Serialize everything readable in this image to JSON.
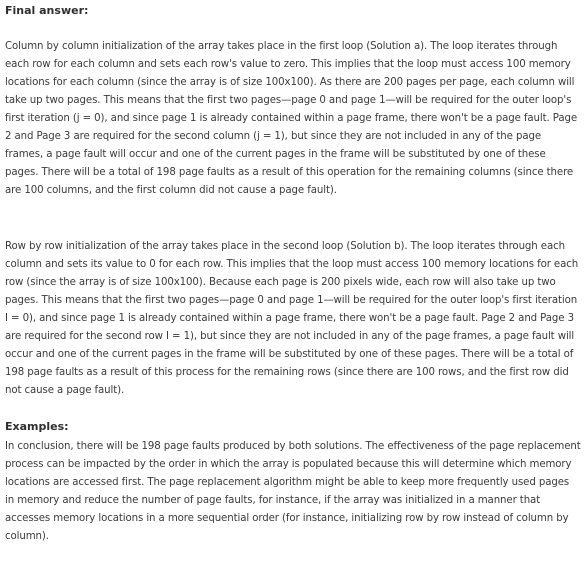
{
  "final_answer": {
    "heading": "Final answer:",
    "paragraph_1": "Column by column initialization of the array takes place in the first loop (Solution a). The loop iterates through each row for each column and sets each row's value to zero. This implies that the loop must access 100 memory locations for each column (since the array is of size 100x100). As there are 200 pages per page, each column will take up two pages. This means that the first two pages—page 0 and page 1—will be required for the outer loop's first iteration (j = 0), and since page 1 is already contained within a page frame, there won't be a page fault. Page 2 and Page 3 are required for the second column (j = 1), but since they are not included in any of the page frames, a page fault will occur and one of the current pages in the frame will be substituted by one of these pages. There will be a total of 198 page faults as a result of this operation for the remaining columns (since there are 100 columns, and the first column did not cause a page fault).",
    "paragraph_2": "Row by row initialization of the array takes place in the second loop (Solution b). The loop iterates through each column and sets its value to 0 for each row. This implies that the loop must access 100 memory locations for each row (since the array is of size 100x100). Because each page is 200 pixels wide, each row will also take up two pages. This means that the first two pages—page 0 and page 1—will be required for the outer loop's first iteration I = 0), and since page 1 is already contained within a page frame, there won't be a page fault. Page 2 and Page 3 are required for the second row I = 1), but since they are not included in any of the page frames, a page fault will occur and one of the current pages in the frame will be substituted by one of these pages. There will be a total of 198 page faults as a result of this process for the remaining rows (since there are 100 rows, and the first row did not cause a page fault)."
  },
  "examples": {
    "heading": "Examples:",
    "paragraph": "In conclusion, there will be 198 page faults produced by both solutions. The effectiveness of the page replacement process can be impacted by the order in which the array is populated because this will determine which memory locations are accessed first. The page replacement algorithm might be able to keep more frequently used pages in memory and reduce the number of page faults, for instance, if the array was initialized in a manner that accesses memory locations in a more sequential order (for instance, initializing row by row instead of column by column)."
  }
}
